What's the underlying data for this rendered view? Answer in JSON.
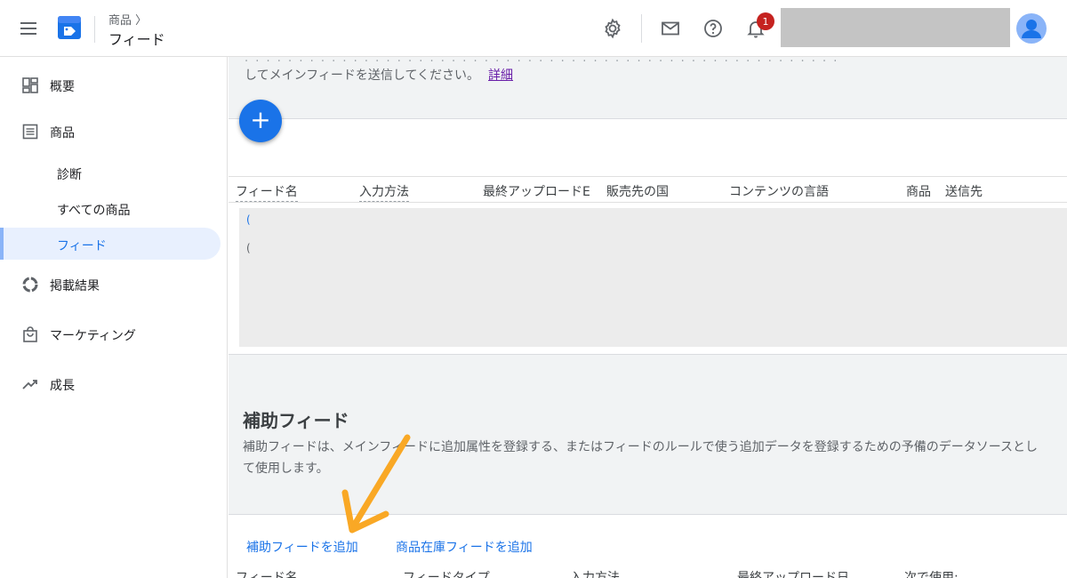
{
  "header": {
    "breadcrumb_parent": "商品 〉",
    "title": "フィード",
    "notification_count": "1"
  },
  "sidebar": {
    "items": [
      {
        "label": "概要"
      },
      {
        "label": "商品"
      },
      {
        "label": "診断"
      },
      {
        "label": "すべての商品"
      },
      {
        "label": "フィード"
      },
      {
        "label": "掲載結果"
      },
      {
        "label": "マーケティング"
      },
      {
        "label": "成長"
      }
    ]
  },
  "main_feeds": {
    "description": "してメインフィードを送信してください。",
    "learn_more": "詳細",
    "add_button": "+",
    "columns": [
      "フィード名",
      "入力方法",
      "最終アップロードE",
      "販売先の国",
      "コンテンツの言語",
      "商品",
      "送信先"
    ]
  },
  "supplemental": {
    "title": "補助フィード",
    "description": "補助フィードは、メインフィードに追加属性を登録する、またはフィードのルールで使う追加データを登録するための予備のデータソースとして使用します。",
    "add_supplemental": "補助フィードを追加",
    "add_inventory": "商品在庫フィードを追加",
    "columns": [
      "フィード名",
      "フィードタイプ",
      "入力方法",
      "最終アップロード日",
      "次で使用:"
    ]
  },
  "colors": {
    "accent": "#1a73e8",
    "arrow": "#f9a825"
  }
}
